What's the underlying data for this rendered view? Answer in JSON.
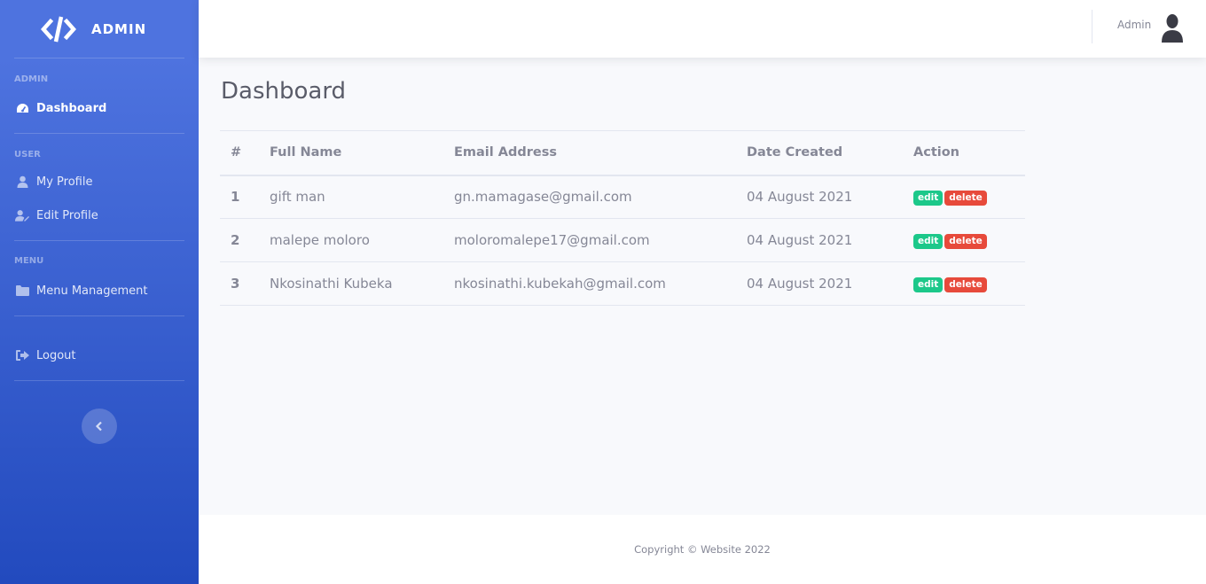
{
  "brand": {
    "name": "ADMIN",
    "icon": "code-icon"
  },
  "sidebar": {
    "sections": [
      {
        "heading": "ADMIN",
        "items": [
          {
            "label": "Dashboard",
            "icon": "tachometer-icon",
            "active": true
          }
        ]
      },
      {
        "heading": "USER",
        "items": [
          {
            "label": "My Profile",
            "icon": "user-icon"
          },
          {
            "label": "Edit Profile",
            "icon": "user-edit-icon"
          }
        ]
      },
      {
        "heading": "MENU",
        "items": [
          {
            "label": "Menu Management",
            "icon": "folder-icon"
          }
        ]
      }
    ],
    "logout": {
      "label": "Logout",
      "icon": "sign-out-icon"
    },
    "toggle_icon": "chevron-left-icon"
  },
  "topbar": {
    "user_name": "Admin",
    "avatar_icon": "user-avatar-icon"
  },
  "main": {
    "title": "Dashboard",
    "table": {
      "headers": [
        "#",
        "Full Name",
        "Email Address",
        "Date Created",
        "Action"
      ],
      "rows": [
        {
          "num": "1",
          "name": "gift man",
          "email": "gn.mamagase@gmail.com",
          "date": "04 August 2021"
        },
        {
          "num": "2",
          "name": "malepe moloro",
          "email": "moloromalepe17@gmail.com",
          "date": "04 August 2021"
        },
        {
          "num": "3",
          "name": "Nkosinathi Kubeka",
          "email": "nkosinathi.kubekah@gmail.com",
          "date": "04 August 2021"
        }
      ],
      "actions": {
        "edit": "edit",
        "delete": "delete"
      }
    }
  },
  "footer": {
    "copyright": "Copyright © Website 2022"
  },
  "colors": {
    "primary": "#4e73df",
    "success": "#1cc88a",
    "danger": "#e74a3b",
    "text": "#858796",
    "title": "#5a5c69"
  }
}
